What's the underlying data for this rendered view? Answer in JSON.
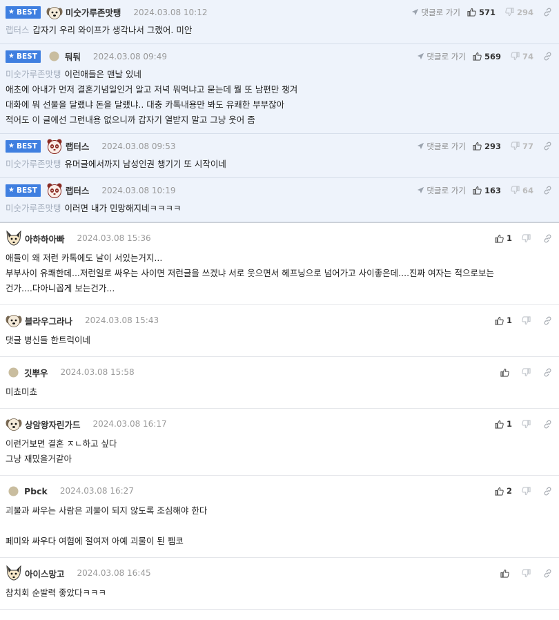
{
  "labels": {
    "best": "BEST",
    "reply_link": "댓글로 가기"
  },
  "best_comments": [
    {
      "nick": "미숫가루존맛탱",
      "avatar": "dog-face",
      "date": "2024.03.08 10:12",
      "up": "571",
      "down": "294",
      "reply_to": "랩터스",
      "lines": [
        "갑자기 우리 와이프가 생각나서 그랬어. 미안"
      ]
    },
    {
      "nick": "둬둬",
      "avatar": "round-dot",
      "date": "2024.03.08 09:49",
      "up": "569",
      "down": "74",
      "reply_to": "미숫가루존맛탱",
      "lines": [
        "이런애들은 맨날 있네",
        "애초에 아내가 먼저 결혼기념일인거 알고 저녁 뭐먹냐고 묻는데 뭘 또 남편만 챙겨",
        "대화에 뭐 선물을 달랬냐 돈을 달랬냐.. 대충 카톡내용만 봐도 유쾌한 부부잖아",
        "적어도 이 글에선 그런내용 없으니까 갑자기 열받지 말고 그냥 웃어 좀"
      ]
    },
    {
      "nick": "랩터스",
      "avatar": "panda-face",
      "date": "2024.03.08 09:53",
      "up": "293",
      "down": "77",
      "reply_to": "미숫가루존맛탱",
      "lines": [
        "유머글에서까지 남성인권 챙기기 또 시작이네"
      ]
    },
    {
      "nick": "랩터스",
      "avatar": "panda-face",
      "date": "2024.03.08 10:19",
      "up": "163",
      "down": "64",
      "reply_to": "미숫가루존맛탱",
      "lines": [
        "이러면 내가 민망해지네ㅋㅋㅋㅋ"
      ]
    }
  ],
  "comments": [
    {
      "nick": "아하하아빠",
      "avatar": "fox-face",
      "date": "2024.03.08 15:36",
      "up": "1",
      "lines": [
        "애들이 왜 저런 카톡에도 날이 서있는거지...",
        "부부사이 유쾌한데...저런일로 싸우는 사이면 저런글을 쓰겠냐 서로 웃으면서 헤프닝으로 넘어가고 사이좋은데....진짜 여자는 적으로보는",
        "건가....다아니꼽게 보는건가..."
      ]
    },
    {
      "nick": "블라우그라나",
      "avatar": "dog-face",
      "date": "2024.03.08 15:43",
      "up": "1",
      "lines": [
        "댓글 병신들 한트럭이네"
      ]
    },
    {
      "nick": "깃뿌우",
      "avatar": "round-dot",
      "date": "2024.03.08 15:58",
      "up": "",
      "lines": [
        "미쵸미쵸"
      ]
    },
    {
      "nick": "상암왕자린가드",
      "avatar": "dog-face",
      "date": "2024.03.08 16:17",
      "up": "1",
      "lines": [
        "이런거보면 결혼 ㅈㄴ하고 싶다",
        "그냥 재밌을거같아"
      ]
    },
    {
      "nick": "Pbck",
      "avatar": "round-dot",
      "date": "2024.03.08 16:27",
      "up": "2",
      "lines": [
        "괴물과 싸우는 사람은 괴물이 되지 않도록 조심해야 한다",
        "",
        "페미와 싸우다 여혐에 절여져 아예 괴물이 된 펨코"
      ]
    },
    {
      "nick": "아이스망고",
      "avatar": "fox-face",
      "date": "2024.03.08 16:45",
      "up": "",
      "lines": [
        "참치회 순발력 좋았다ㅋㅋㅋ"
      ]
    }
  ]
}
